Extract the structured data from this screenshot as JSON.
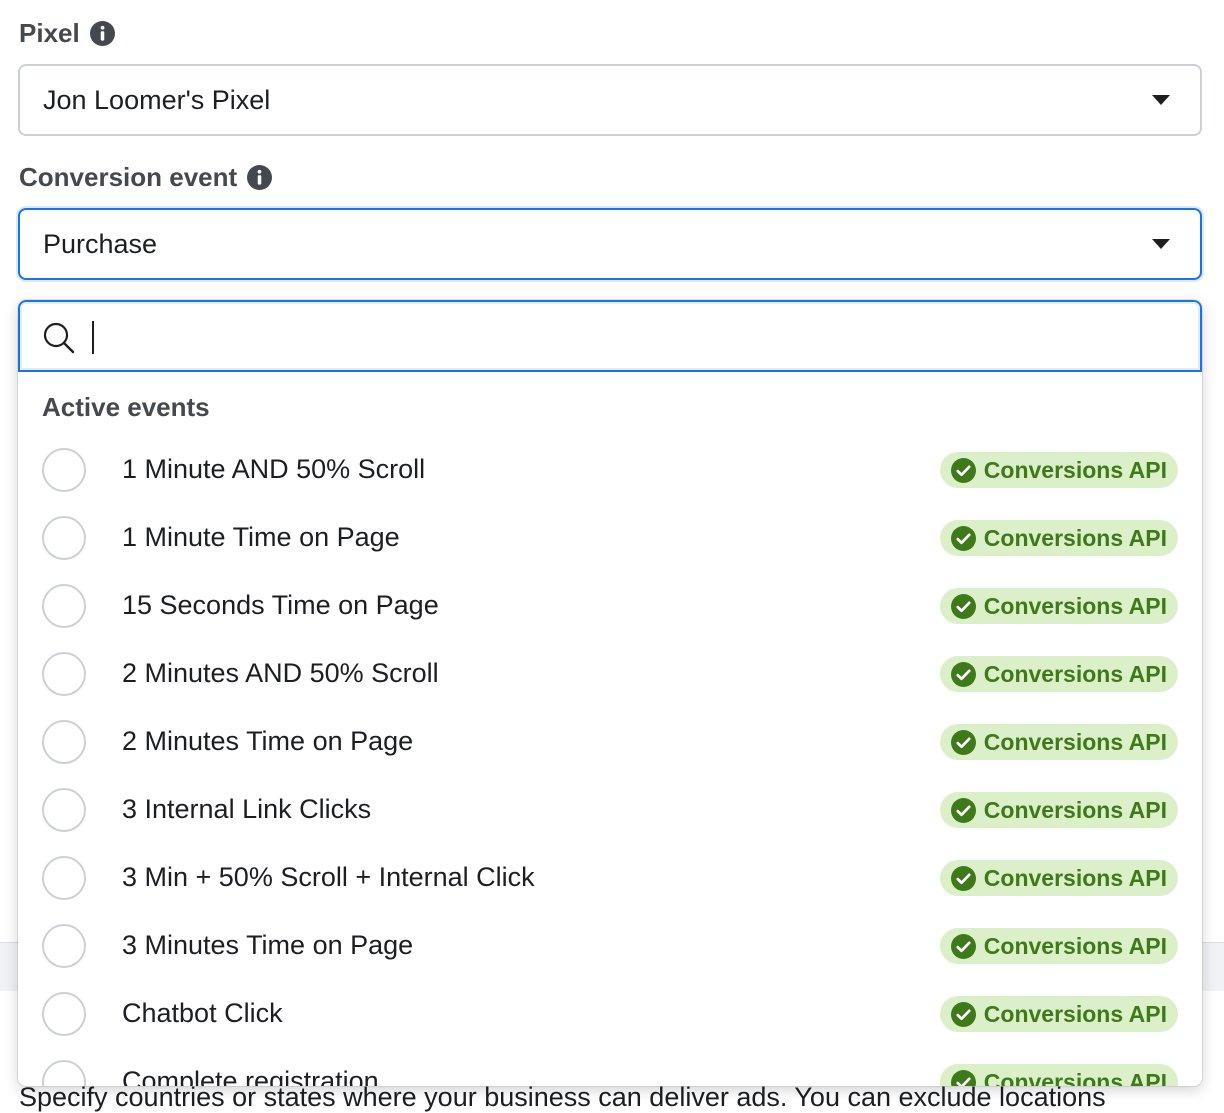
{
  "pixel": {
    "label": "Pixel",
    "selected": "Jon Loomer's Pixel"
  },
  "conversion_event": {
    "label": "Conversion event",
    "selected": "Purchase"
  },
  "dropdown": {
    "search_value": "",
    "section_title": "Active events",
    "events": [
      {
        "name": "1 Minute AND 50% Scroll",
        "badge": "Conversions API"
      },
      {
        "name": "1 Minute Time on Page",
        "badge": "Conversions API"
      },
      {
        "name": "15 Seconds Time on Page",
        "badge": "Conversions API"
      },
      {
        "name": "2 Minutes AND 50% Scroll",
        "badge": "Conversions API"
      },
      {
        "name": "2 Minutes Time on Page",
        "badge": "Conversions API"
      },
      {
        "name": "3 Internal Link Clicks",
        "badge": "Conversions API"
      },
      {
        "name": "3 Min + 50% Scroll + Internal Click",
        "badge": "Conversions API"
      },
      {
        "name": "3 Minutes Time on Page",
        "badge": "Conversions API"
      },
      {
        "name": "Chatbot Click",
        "badge": "Conversions API"
      },
      {
        "name": "Complete registration",
        "badge": "Conversions API"
      }
    ]
  },
  "background": {
    "locations_help_text": "Specify countries or states where your business can deliver ads. You can exclude locations"
  },
  "colors": {
    "focus_blue": "#1b74e4",
    "badge_bg": "#dbf0c8",
    "badge_green": "#3f7a1a"
  }
}
